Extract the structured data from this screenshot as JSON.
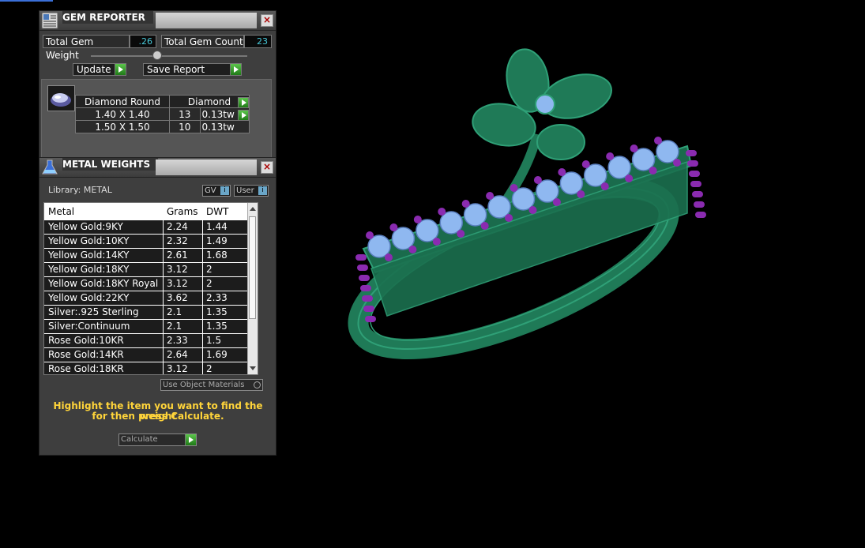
{
  "gem_reporter": {
    "title": "GEM REPORTER",
    "total_weight_label": "Total Gem Weight",
    "total_weight_value": ".26",
    "total_count_label": "Total Gem Count",
    "total_count_value": "23",
    "update_label": "Update",
    "save_report_label": "Save Report",
    "table_header_shape": "Diamond Round",
    "table_header_material": "Diamond",
    "rows": [
      {
        "size": "1.40 X 1.40",
        "count": "13",
        "weight": "0.13tw"
      },
      {
        "size": "1.50 X 1.50",
        "count": "10",
        "weight": "0.13tw"
      }
    ]
  },
  "metal_weights": {
    "title": "METAL WEIGHTS",
    "library_label": "Library: METAL",
    "gv_label": "GV",
    "user_label": "User",
    "columns": [
      "Metal",
      "Grams",
      "DWT"
    ],
    "rows": [
      {
        "metal": "Yellow Gold:9KY",
        "grams": "2.24",
        "dwt": "1.44"
      },
      {
        "metal": "Yellow Gold:10KY",
        "grams": "2.32",
        "dwt": "1.49"
      },
      {
        "metal": "Yellow Gold:14KY",
        "grams": "2.61",
        "dwt": "1.68"
      },
      {
        "metal": "Yellow Gold:18KY",
        "grams": "3.12",
        "dwt": "2"
      },
      {
        "metal": "Yellow Gold:18KY Royal",
        "grams": "3.12",
        "dwt": "2"
      },
      {
        "metal": "Yellow Gold:22KY",
        "grams": "3.62",
        "dwt": "2.33"
      },
      {
        "metal": "Silver:.925 Sterling",
        "grams": "2.1",
        "dwt": "1.35"
      },
      {
        "metal": "Silver:Continuum",
        "grams": "2.1",
        "dwt": "1.35"
      },
      {
        "metal": "Rose Gold:10KR",
        "grams": "2.33",
        "dwt": "1.5"
      },
      {
        "metal": "Rose Gold:14KR",
        "grams": "2.64",
        "dwt": "1.69"
      },
      {
        "metal": "Rose Gold:18KR",
        "grams": "3.12",
        "dwt": "2"
      }
    ],
    "use_object_materials_label": "Use Object Materials",
    "hint_line1": "Highlight the item you want to find the weight",
    "hint_line2": "for then press Calculate.",
    "calculate_label": "Calculate"
  },
  "colors": {
    "ring_metal": "#1f7a57",
    "ring_edge": "#2fa077",
    "gem_blue": "#8fb8f0",
    "prong_purple": "#8a2bb0",
    "hint_yellow": "#ffd43a",
    "value_cyan": "#47c8d8"
  }
}
